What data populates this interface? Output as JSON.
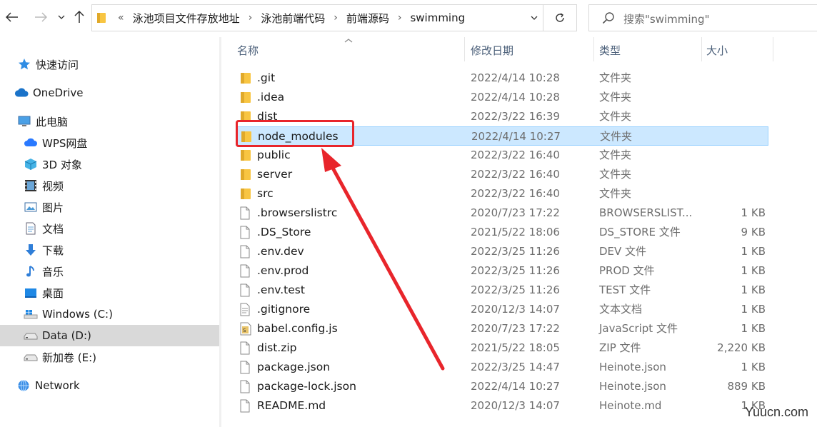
{
  "address_bar": {
    "overflow_mark": "«",
    "breadcrumbs": [
      "泳池项目文件存放地址",
      "泳池前端代码",
      "前端源码",
      "swimming"
    ]
  },
  "search": {
    "placeholder": "搜索\"swimming\""
  },
  "nav": {
    "items": [
      {
        "label": "快速访问",
        "icon": "star-icon"
      },
      {
        "label": "OneDrive",
        "icon": "cloud-icon"
      },
      {
        "label": "此电脑",
        "icon": "computer-icon"
      },
      {
        "label": "WPS网盘",
        "icon": "wps-cloud-icon"
      },
      {
        "label": "3D 对象",
        "icon": "cube-icon"
      },
      {
        "label": "视频",
        "icon": "video-icon"
      },
      {
        "label": "图片",
        "icon": "picture-icon"
      },
      {
        "label": "文档",
        "icon": "document-icon"
      },
      {
        "label": "下载",
        "icon": "download-icon"
      },
      {
        "label": "音乐",
        "icon": "music-icon"
      },
      {
        "label": "桌面",
        "icon": "desktop-icon"
      },
      {
        "label": "Windows (C:)",
        "icon": "windows-drive-icon"
      },
      {
        "label": "Data (D:)",
        "icon": "drive-icon",
        "selected": true
      },
      {
        "label": "新加卷 (E:)",
        "icon": "drive-icon"
      },
      {
        "label": "Network",
        "icon": "network-icon"
      }
    ]
  },
  "columns": {
    "name": "名称",
    "modified": "修改日期",
    "type": "类型",
    "size": "大小"
  },
  "files": [
    {
      "name": ".git",
      "date": "2022/4/14 10:28",
      "type": "文件夹",
      "size": "",
      "icon": "folder-icon"
    },
    {
      "name": ".idea",
      "date": "2022/4/14 10:28",
      "type": "文件夹",
      "size": "",
      "icon": "folder-icon"
    },
    {
      "name": "dist",
      "date": "2022/3/22 16:39",
      "type": "文件夹",
      "size": "",
      "icon": "folder-icon"
    },
    {
      "name": "node_modules",
      "date": "2022/4/14 10:27",
      "type": "文件夹",
      "size": "",
      "icon": "folder-icon",
      "selected": true
    },
    {
      "name": "public",
      "date": "2022/3/22 16:40",
      "type": "文件夹",
      "size": "",
      "icon": "folder-icon"
    },
    {
      "name": "server",
      "date": "2022/3/22 16:40",
      "type": "文件夹",
      "size": "",
      "icon": "folder-icon"
    },
    {
      "name": "src",
      "date": "2022/3/22 16:40",
      "type": "文件夹",
      "size": "",
      "icon": "folder-icon"
    },
    {
      "name": ".browserslistrc",
      "date": "2020/7/23 17:22",
      "type": "BROWSERSLIST...",
      "size": "1 KB",
      "icon": "file-icon"
    },
    {
      "name": ".DS_Store",
      "date": "2021/5/22 18:06",
      "type": "DS_STORE 文件",
      "size": "9 KB",
      "icon": "file-icon"
    },
    {
      "name": ".env.dev",
      "date": "2022/3/25 11:26",
      "type": "DEV 文件",
      "size": "1 KB",
      "icon": "file-icon"
    },
    {
      "name": ".env.prod",
      "date": "2022/3/25 11:26",
      "type": "PROD 文件",
      "size": "1 KB",
      "icon": "file-icon"
    },
    {
      "name": ".env.test",
      "date": "2022/3/25 11:26",
      "type": "TEST 文件",
      "size": "1 KB",
      "icon": "file-icon"
    },
    {
      "name": ".gitignore",
      "date": "2020/12/3 14:07",
      "type": "文本文档",
      "size": "1 KB",
      "icon": "text-file-icon"
    },
    {
      "name": "babel.config.js",
      "date": "2020/7/23 17:22",
      "type": "JavaScript 文件",
      "size": "1 KB",
      "icon": "js-file-icon"
    },
    {
      "name": "dist.zip",
      "date": "2021/5/22 18:05",
      "type": "ZIP 文件",
      "size": "2,220 KB",
      "icon": "file-icon"
    },
    {
      "name": "package.json",
      "date": "2022/3/25 14:47",
      "type": "Heinote.json",
      "size": "1 KB",
      "icon": "file-icon"
    },
    {
      "name": "package-lock.json",
      "date": "2022/4/14 10:27",
      "type": "Heinote.json",
      "size": "889 KB",
      "icon": "file-icon"
    },
    {
      "name": "README.md",
      "date": "2020/12/3 14:07",
      "type": "Heinote.md",
      "size": "1 KB",
      "icon": "file-icon"
    }
  ],
  "watermark": "Yuucn.com",
  "colors": {
    "highlight": "#e8252b",
    "selection": "#cce8ff",
    "folder": "#f8c542"
  }
}
